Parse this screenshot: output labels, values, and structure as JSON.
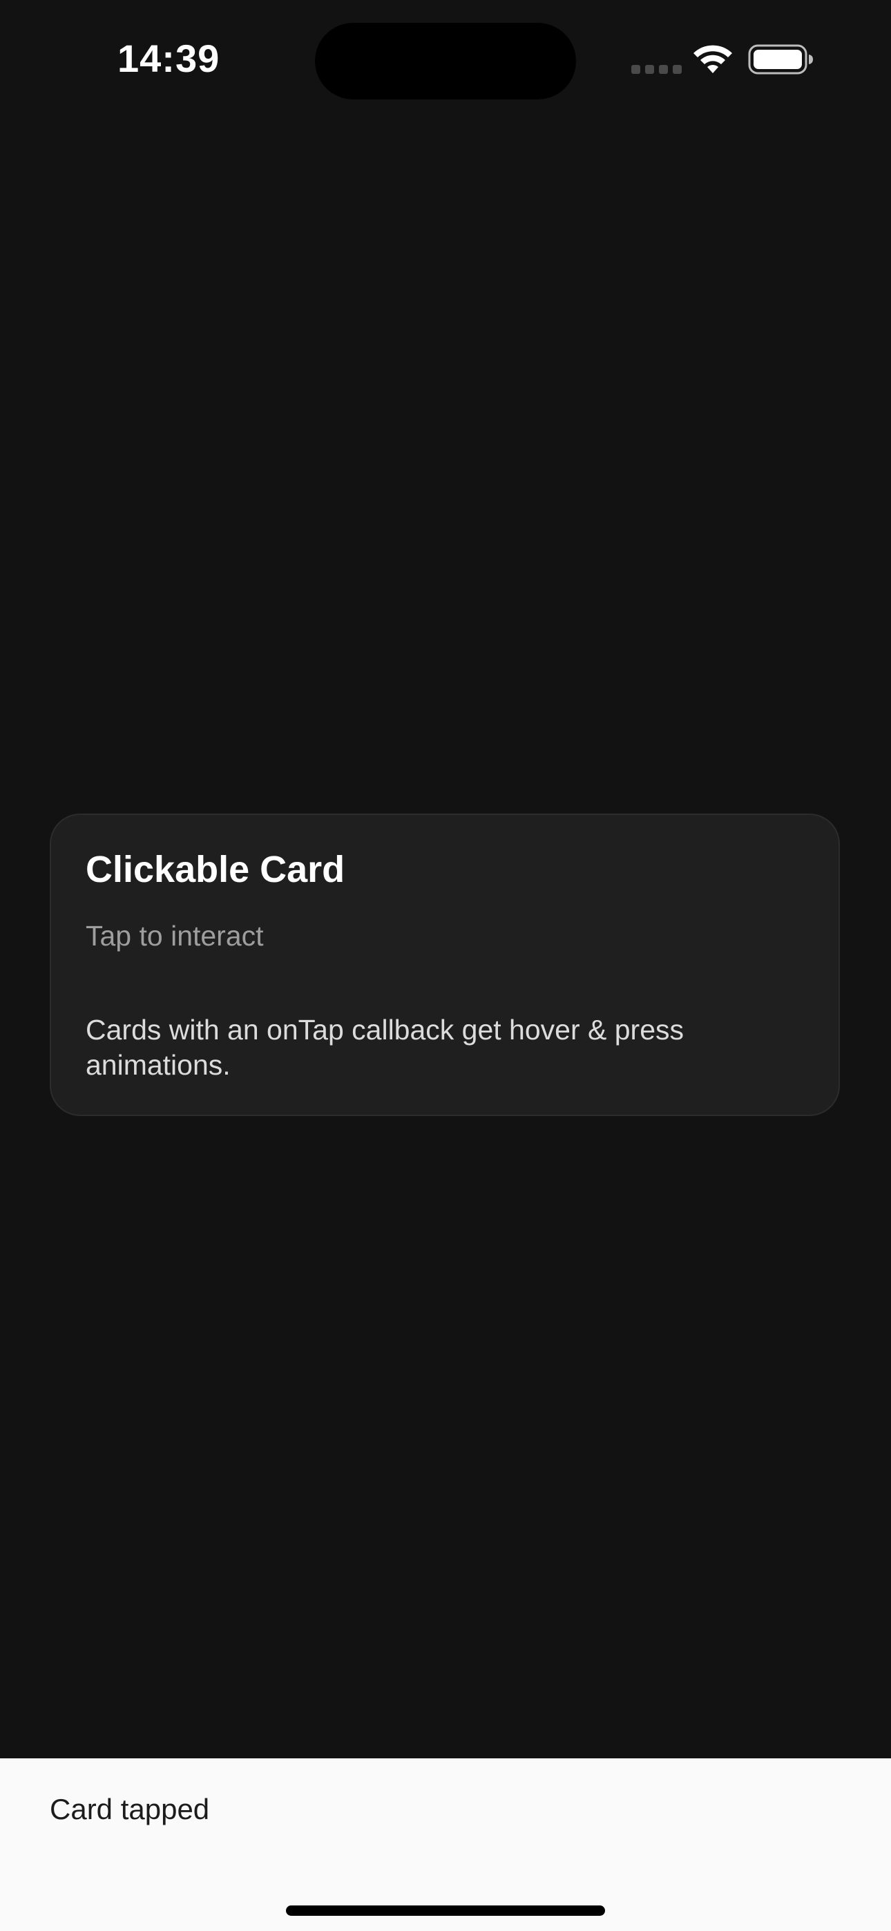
{
  "status_bar": {
    "time": "14:39",
    "icons": [
      "signal-dots-icon",
      "wifi-icon",
      "battery-icon"
    ]
  },
  "card": {
    "title": "Clickable Card",
    "subtitle": "Tap to interact",
    "body": "Cards with an onTap callback get hover & press animations."
  },
  "snackbar": {
    "message": "Card tapped"
  },
  "colors": {
    "background": "#121212",
    "card_background": "#1f1f1f",
    "card_border": "#2c2c2c",
    "title_text": "#ffffff",
    "subtitle_text": "#9e9e9e",
    "snackbar_background": "#fafafa",
    "snackbar_text": "#1c1c1c"
  }
}
